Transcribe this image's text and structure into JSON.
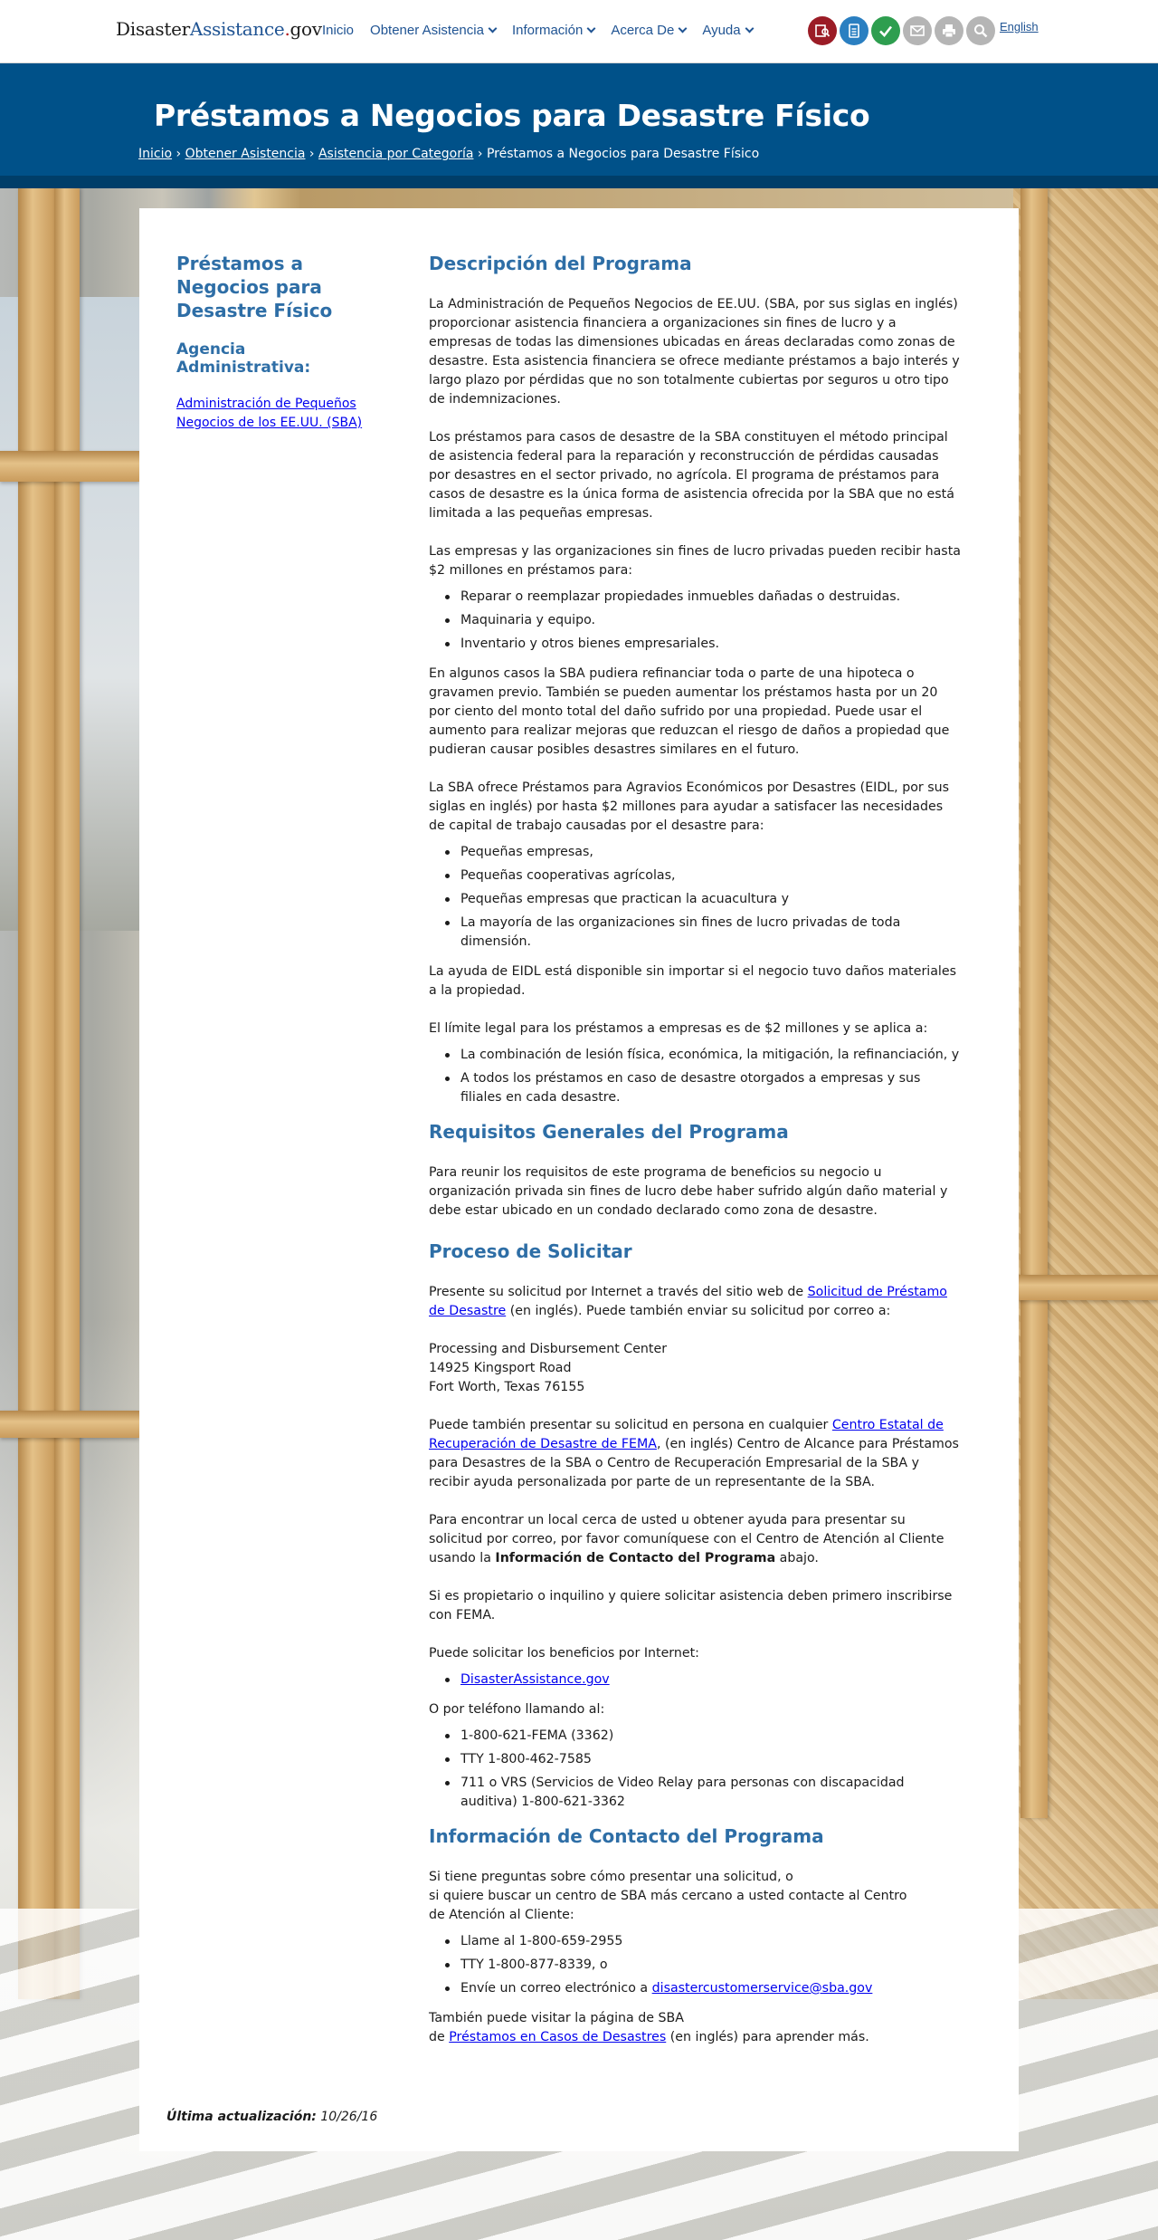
{
  "header": {
    "logo": {
      "part1": "Disaster",
      "part2": "Assistance",
      "dot": ".",
      "part3": "gov"
    },
    "nav": [
      {
        "label": "Inicio",
        "has_menu": false
      },
      {
        "label": "Obtener Asistencia",
        "has_menu": true
      },
      {
        "label": "Información",
        "has_menu": true
      },
      {
        "label": "Acerca De",
        "has_menu": true
      },
      {
        "label": "Ayuda",
        "has_menu": true
      }
    ],
    "tools": [
      {
        "icon": "find-assistance-icon",
        "color": "#9b1c26"
      },
      {
        "icon": "apply-checklist-icon",
        "color": "#2a7fc1"
      },
      {
        "icon": "check-status-icon",
        "color": "#2e9e4f"
      },
      {
        "icon": "email-icon",
        "color": "#b5b5b5"
      },
      {
        "icon": "print-icon",
        "color": "#b5b5b5"
      },
      {
        "icon": "search-icon",
        "color": "#b5b5b5"
      }
    ],
    "language_link": "English"
  },
  "banner": {
    "title": "Préstamos a Negocios para Desastre Físico",
    "breadcrumbs": [
      {
        "label": "Inicio",
        "link": true
      },
      {
        "label": "Obtener Asistencia",
        "link": true
      },
      {
        "label": "Asistencia por Categoría",
        "link": true
      },
      {
        "label": "Préstamos a Negocios para Desastre Físico",
        "link": false
      }
    ],
    "separator": "›"
  },
  "sidebar": {
    "title": "Préstamos a Negocios para Desastre Físico",
    "agency_heading": "Agencia Administrativa:",
    "agency_link": "Administración de Pequeños Negocios de los EE.UU. (SBA)"
  },
  "main": {
    "h_description": "Descripción del Programa",
    "p1": "La Administración de Pequeños Negocios de EE.UU. (SBA, por sus siglas en inglés) proporcionar asistencia financiera a organizaciones sin fines de lucro y a empresas de todas las dimensiones ubicadas en áreas declaradas como zonas de desastre. Esta asistencia financiera se ofrece mediante préstamos a bajo interés y largo plazo por pérdidas que no son totalmente cubiertas por seguros u otro tipo de indemnizaciones.",
    "p2": "Los préstamos para casos de desastre de la SBA constituyen el método principal de asistencia federal para la reparación y reconstrucción de pérdidas causadas por desastres en el sector privado, no agrícola. El programa de préstamos para casos de desastre es la única forma de asistencia ofrecida por la SBA que no está limitada a las pequeñas empresas.",
    "p3": "Las empresas y las organizaciones sin fines de lucro privadas pueden recibir hasta $2 millones en préstamos para:",
    "list1": [
      "Reparar o reemplazar propiedades inmuebles dañadas o destruidas.",
      "Maquinaria y equipo.",
      "Inventario y otros bienes empresariales."
    ],
    "p4": "En algunos casos la SBA pudiera refinanciar toda o parte de una hipoteca o gravamen previo. También se pueden aumentar los préstamos hasta por un 20 por ciento del monto total del daño sufrido por una propiedad. Puede usar el aumento para realizar mejoras que reduzcan el riesgo de daños a propiedad que pudieran causar posibles desastres similares en el futuro.",
    "p5": "La SBA ofrece Préstamos para Agravios Económicos por Desastres (EIDL, por sus siglas en inglés) por hasta $2 millones para ayudar a satisfacer las necesidades de capital de trabajo causadas por el desastre para:",
    "list2": [
      "Pequeñas empresas,",
      "Pequeñas cooperativas agrícolas,",
      "Pequeñas empresas que practican la acuacultura y",
      "La mayoría de las organizaciones sin fines de lucro privadas de toda dimensión."
    ],
    "p6": "La ayuda de EIDL está disponible sin importar si el negocio tuvo daños materiales a la propiedad.",
    "p7": "El límite legal para los préstamos a empresas es de $2 millones y se aplica a:",
    "list3": [
      "La combinación de lesión física, económica, la mitigación, la refinanciación, y",
      "A todos los préstamos en caso de desastre otorgados a empresas y sus filiales en cada desastre."
    ],
    "h_requirements": "Requisitos Generales del Programa",
    "p8": "Para reunir los requisitos de este programa de beneficios su negocio u organización privada sin fines de lucro debe haber sufrido algún daño material y debe estar ubicado en un condado declarado como zona de desastre.",
    "h_process": "Proceso de Solicitar",
    "p9_a": "Presente su solicitud por Internet a través del sitio web de ",
    "p9_link": "Solicitud de Préstamo de Desastre",
    "p9_b": " (en inglés). Puede también enviar su solicitud por correo a:",
    "address": [
      "Processing and Disbursement Center",
      "14925 Kingsport Road",
      "Fort Worth, Texas 76155"
    ],
    "p10_a": "Puede también presentar su solicitud en persona en cualquier ",
    "p10_link": "Centro Estatal de Recuperación de Desastre de FEMA",
    "p10_b": ", (en inglés) Centro de Alcance para Préstamos para Desastres de la SBA o Centro de Recuperación Empresarial de la SBA y recibir ayuda personalizada por parte de un representante de la SBA.",
    "p11_a": "Para encontrar un local cerca de usted u obtener ayuda para presentar su solicitud por correo, por favor comuníquese con el Centro de Atención al Cliente usando la ",
    "p11_bold": "Información de Contacto del Programa",
    "p11_b": " abajo.",
    "p12": "Si es propietario o inquilino y quiere solicitar asistencia deben primero inscribirse con FEMA.",
    "p13": "Puede solicitar los beneficios por Internet:",
    "online_link": "DisasterAssistance.gov",
    "p14": "O por teléfono llamando al:",
    "phones": [
      "1-800-621-FEMA (3362)",
      "TTY 1-800-462-7585",
      "711 o VRS (Servicios de Video Relay para personas con discapacidad auditiva) 1-800-621-3362"
    ],
    "h_contact": "Información de Contacto del Programa",
    "p15_line1": "Si tiene preguntas sobre cómo presentar una solicitud, o",
    "p15_line2": "si quiere buscar un centro de SBA más cercano a usted contacte al Centro",
    "p15_line3": "de Atención al Cliente:",
    "contact_items": [
      "Llame al 1-800-659-2955",
      "TTY 1-800-877-8339, o"
    ],
    "email_prefix": "Envíe un correo electrónico a ",
    "email_link": "disastercustomerservice@sba.gov",
    "p16_line1": "También puede visitar la página de SBA",
    "p16_a": "de ",
    "p16_link": "Préstamos en Casos de Desastres",
    "p16_b": " (en inglés) para aprender más."
  },
  "footer": {
    "updated_label": "Última actualización:",
    "updated_date": "10/26/16"
  }
}
